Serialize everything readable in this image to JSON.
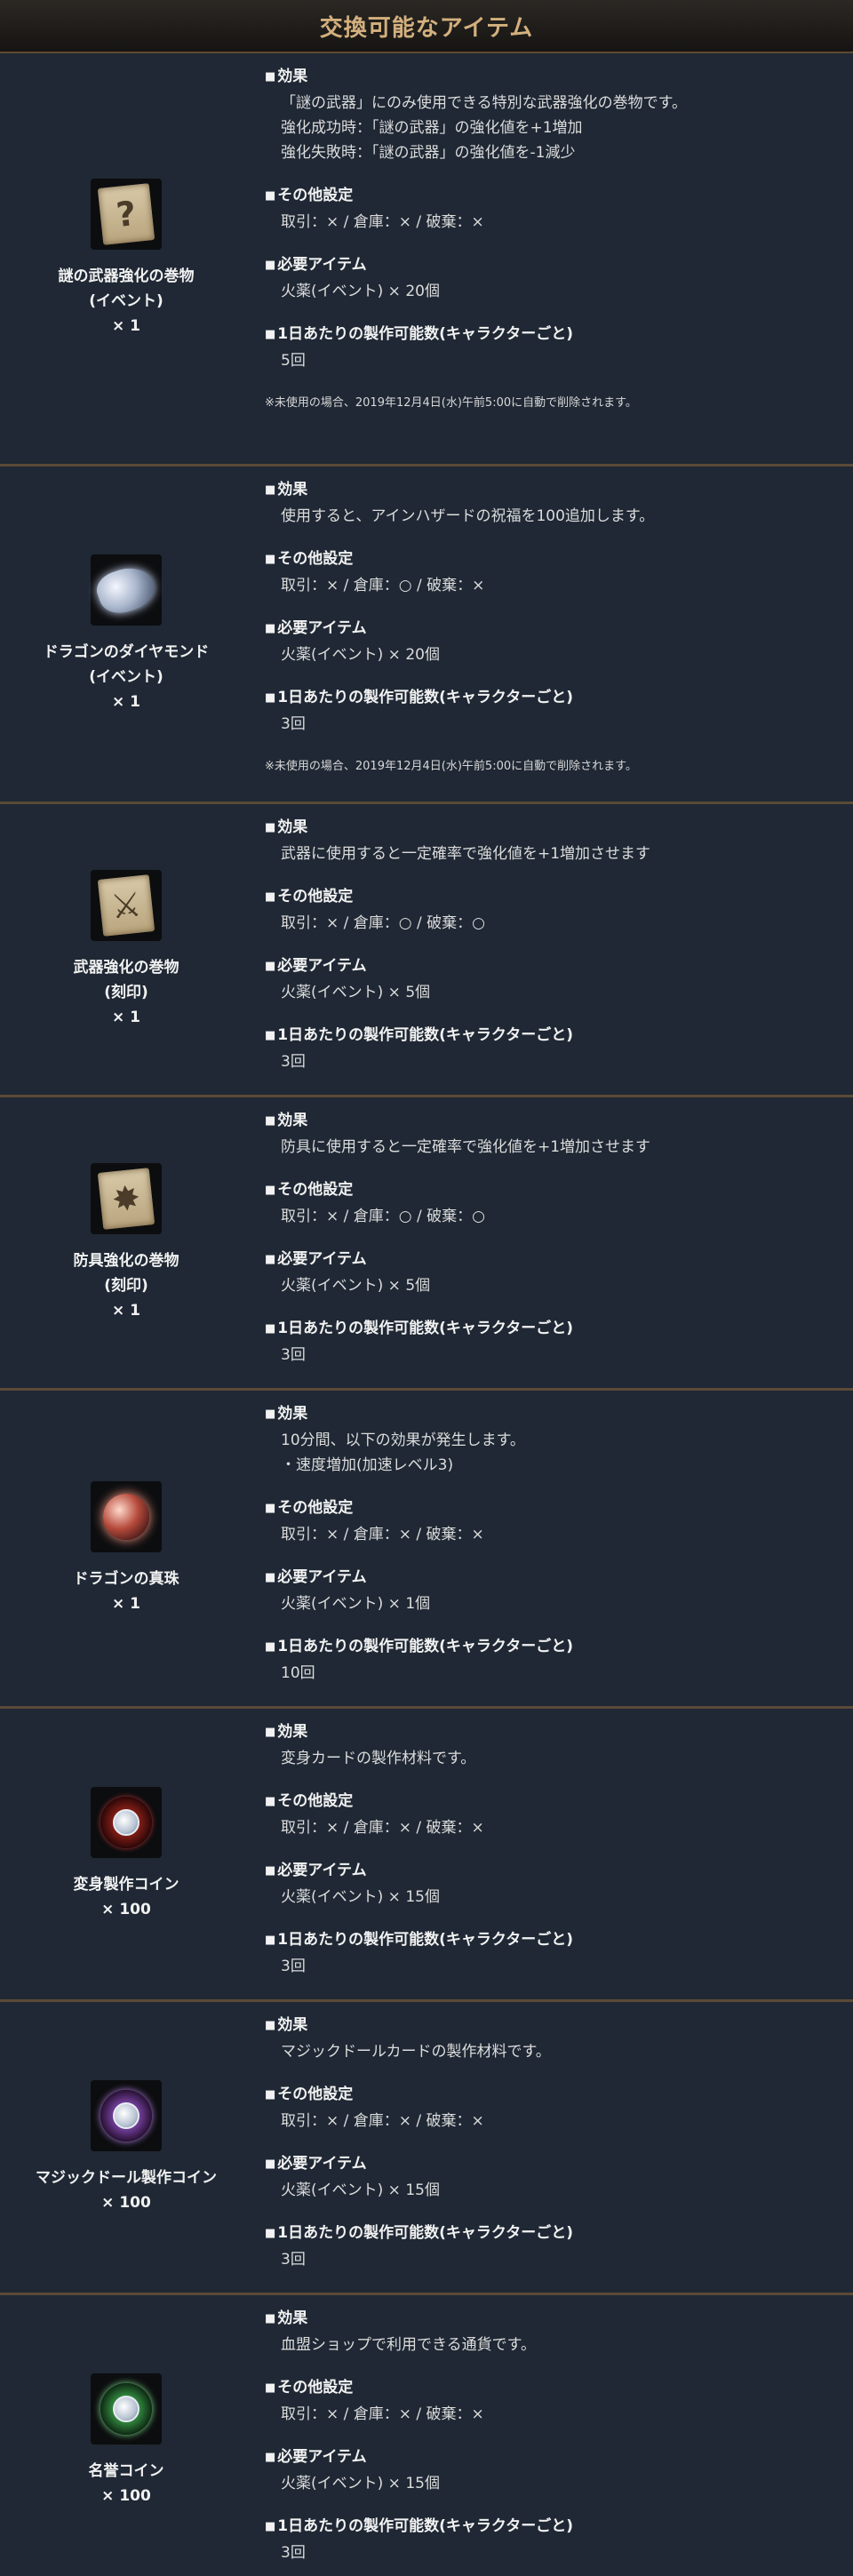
{
  "header": {
    "title": "交換可能なアイテム"
  },
  "items": [
    {
      "name": "謎の武器強化の巻物\n(イベント)",
      "qty": "× 1",
      "icon": "mystery-scroll-icon",
      "effect_title": "効果",
      "effect": [
        "「謎の武器」にのみ使用できる特別な武器強化の巻物です。",
        "",
        "強化成功時：「謎の武器」の強化値を+1増加",
        "強化失敗時：「謎の武器」の強化値を-1減少"
      ],
      "other_title": "その他設定",
      "other": "取引：× / 倉庫：× / 破棄：×",
      "req_title": "必要アイテム",
      "req": "火薬(イベント) × 20個",
      "daily_title": "1日あたりの製作可能数(キャラクターごと)",
      "daily": "5回",
      "note": "※未使用の場合、2019年12月4日(水)午前5:00に自動で削除されます。"
    },
    {
      "name": "ドラゴンのダイヤモンド\n(イベント)",
      "qty": "× 1",
      "icon": "dragon-diamond-icon",
      "effect_title": "効果",
      "effect": [
        "使用すると、アインハザードの祝福を100追加します。"
      ],
      "other_title": "その他設定",
      "other": "取引：× / 倉庫：○ / 破棄：×",
      "req_title": "必要アイテム",
      "req": "火薬(イベント) × 20個",
      "daily_title": "1日あたりの製作可能数(キャラクターごと)",
      "daily": "3回",
      "note": "※未使用の場合、2019年12月4日(水)午前5:00に自動で削除されます。"
    },
    {
      "name": "武器強化の巻物\n(刻印)",
      "qty": "× 1",
      "icon": "weapon-scroll-icon",
      "effect_title": "効果",
      "effect": [
        "武器に使用すると一定確率で強化値を+1増加させます"
      ],
      "other_title": "その他設定",
      "other": "取引：× / 倉庫：○ / 破棄：○",
      "req_title": "必要アイテム",
      "req": "火薬(イベント) × 5個",
      "daily_title": "1日あたりの製作可能数(キャラクターごと)",
      "daily": "3回",
      "note": ""
    },
    {
      "name": "防具強化の巻物\n(刻印)",
      "qty": "× 1",
      "icon": "armor-scroll-icon",
      "effect_title": "効果",
      "effect": [
        "防具に使用すると一定確率で強化値を+1増加させます"
      ],
      "other_title": "その他設定",
      "other": "取引：× / 倉庫：○ / 破棄：○",
      "req_title": "必要アイテム",
      "req": "火薬(イベント) × 5個",
      "daily_title": "1日あたりの製作可能数(キャラクターごと)",
      "daily": "3回",
      "note": ""
    },
    {
      "name": "ドラゴンの真珠",
      "qty": "× 1",
      "icon": "dragon-pearl-icon",
      "effect_title": "効果",
      "effect": [
        "10分間、以下の効果が発生します。",
        "・速度増加(加速レベル3)"
      ],
      "other_title": "その他設定",
      "other": "取引：× / 倉庫：× / 破棄：×",
      "req_title": "必要アイテム",
      "req": "火薬(イベント) × 1個",
      "daily_title": "1日あたりの製作可能数(キャラクターごと)",
      "daily": "10回",
      "note": ""
    },
    {
      "name": "変身製作コイン",
      "qty": "× 100",
      "icon": "transform-coin-icon",
      "effect_title": "効果",
      "effect": [
        "変身カードの製作材料です。"
      ],
      "other_title": "その他設定",
      "other": "取引：× / 倉庫：× / 破棄：×",
      "req_title": "必要アイテム",
      "req": "火薬(イベント) × 15個",
      "daily_title": "1日あたりの製作可能数(キャラクターごと)",
      "daily": "3回",
      "note": ""
    },
    {
      "name": "マジックドール製作コイン",
      "qty": "× 100",
      "icon": "magic-doll-coin-icon",
      "effect_title": "効果",
      "effect": [
        "マジックドールカードの製作材料です。"
      ],
      "other_title": "その他設定",
      "other": "取引：× / 倉庫：× / 破棄：×",
      "req_title": "必要アイテム",
      "req": "火薬(イベント) × 15個",
      "daily_title": "1日あたりの製作可能数(キャラクターごと)",
      "daily": "3回",
      "note": ""
    },
    {
      "name": "名誉コイン",
      "qty": "× 100",
      "icon": "honor-coin-icon",
      "effect_title": "効果",
      "effect": [
        "血盟ショップで利用できる通貨です。"
      ],
      "other_title": "その他設定",
      "other": "取引：× / 倉庫：× / 破棄：×",
      "req_title": "必要アイテム",
      "req": "火薬(イベント) × 15個",
      "daily_title": "1日あたりの製作可能数(キャラクターごと)",
      "daily": "3回",
      "note": ""
    }
  ]
}
